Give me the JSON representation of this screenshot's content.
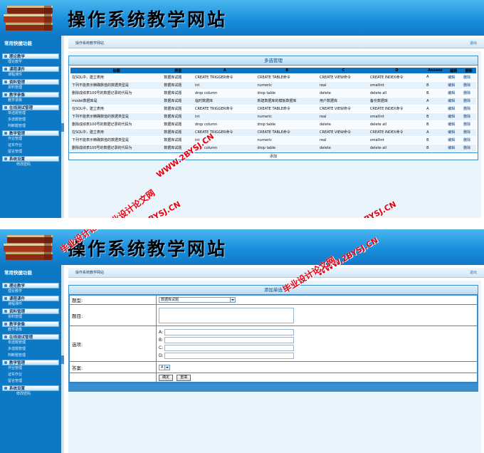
{
  "site": {
    "title": "操作系统教学网站"
  },
  "sidebar": {
    "heading": "常用快捷功能",
    "groups": [
      {
        "title": "理论教学",
        "items": [
          "理论教学"
        ]
      },
      {
        "title": "课程课件",
        "items": [
          "课程课件"
        ]
      },
      {
        "title": "资料管理",
        "items": [
          "资料管理"
        ]
      },
      {
        "title": "教学录像",
        "items": [
          "教学录像"
        ]
      },
      {
        "title": "在线测试管理",
        "items": [
          "单选题管理",
          "多选题管理",
          "判断题管理"
        ]
      },
      {
        "title": "教学管理",
        "items": [
          "作业管理",
          "证实作业",
          "留言管理"
        ]
      },
      {
        "title": "系统设置",
        "items": [
          "修改密码"
        ]
      }
    ]
  },
  "topbar": {
    "crumb": "操作系统教学网站",
    "exit": "退出"
  },
  "screen1": {
    "panel_title": "多选管理",
    "columns": [
      "标题",
      "类型",
      "A",
      "B",
      "C",
      "D",
      "Answer",
      "编辑",
      "删除"
    ],
    "rows": [
      [
        "在SQL中，建立表用",
        "数据库试题",
        "CREATE TRIGGER命令",
        "CREATE TABLE命令",
        "CREATE VIEW命令",
        "CREATE INDEX命令",
        "A",
        "编辑",
        "删除"
      ],
      [
        "下列不能表示精确数值的数据类型是",
        "数据库试题",
        "int",
        "numeric",
        "real",
        "smallint",
        "B",
        "编辑",
        "删除"
      ],
      [
        "删除成绩表100号的数据记录的代码为",
        "数据库试题",
        "drop column",
        "drop table",
        "delete",
        "delete all",
        "B",
        "编辑",
        "删除"
      ],
      [
        "model数据库是",
        "数据库试题",
        "临时数据库",
        "新建数据库的模板数据库",
        "用户数据库",
        "备份数据库",
        "A",
        "编辑",
        "删除"
      ],
      [
        "在SQL中，建立表用",
        "数据库试题",
        "CREATE TRIGGER命令",
        "CREATE TABLE命令",
        "CREATE VIEW命令",
        "CREATE INDEX命令",
        "A",
        "编辑",
        "删除"
      ],
      [
        "下列不能表示精确数值的数据类型是",
        "数据库试题",
        "int",
        "numeric",
        "real",
        "smallint",
        "B",
        "编辑",
        "删除"
      ],
      [
        "删除成绩表100号的数据记录的代码为",
        "数据库试题",
        "drop column",
        "drop table",
        "delete",
        "delete all",
        "B",
        "编辑",
        "删除"
      ],
      [
        "在SQL中，建立表用",
        "数据库试题",
        "CREATE TRIGGER命令",
        "CREATE TABLE命令",
        "CREATE VIEW命令",
        "CREATE INDEX命令",
        "A",
        "编辑",
        "删除"
      ],
      [
        "下列不能表示精确数值的数据类型是",
        "数据库试题",
        "int",
        "numeric",
        "real",
        "smallint",
        "B",
        "编辑",
        "删除"
      ],
      [
        "删除成绩表100号的数据记录的代码为",
        "数据库试题",
        "drop column",
        "drop table",
        "delete",
        "delete all",
        "B",
        "编辑",
        "删除"
      ]
    ],
    "add_label": "添加"
  },
  "screen2": {
    "panel_title": "添加单选",
    "type_label": "题型:",
    "type_value": "数据库试题",
    "question_label": "题目:",
    "options_label": "选项:",
    "option_letters": [
      "A:",
      "B:",
      "C:",
      "D:"
    ],
    "answer_label": "答案:",
    "answer_value": "A",
    "confirm_label": "确定",
    "reset_label": "重填"
  },
  "watermarks": {
    "w1": "WWW.2BYSJ.CN",
    "w2": "毕业设计论文网",
    "w3": "WWW.2BYSJ.CN",
    "w4": "毕业设计论文网",
    "w5": "WWW.2BYSJ.CN",
    "w6": "毕业设计论文网",
    "w7": "WWW.2BYSJ.CN"
  },
  "colors": {
    "header": "#1a8fdc",
    "sidebar": "#0d78c4",
    "accent": "#3b8fd0",
    "watermark": "#e60012"
  }
}
